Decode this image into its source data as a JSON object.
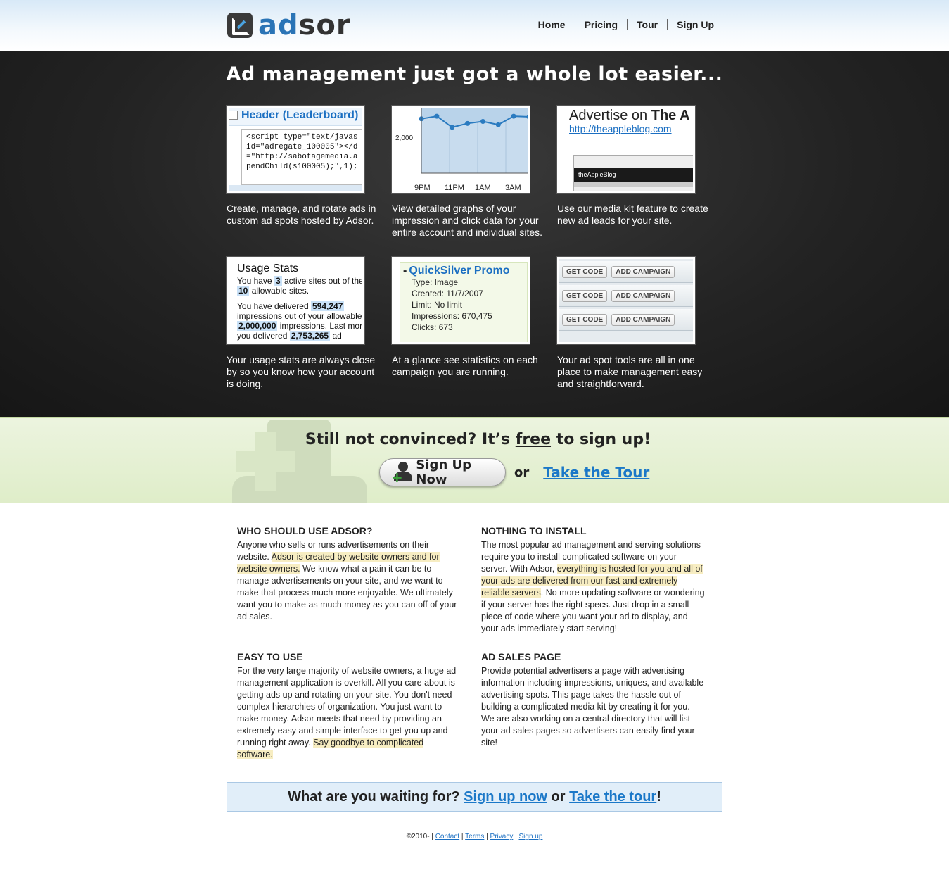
{
  "brand": {
    "logo_ad": "ad",
    "logo_sor": "sor"
  },
  "nav": {
    "home": "Home",
    "pricing": "Pricing",
    "tour": "Tour",
    "signup": "Sign Up"
  },
  "hero": {
    "title": "Ad management just got a whole lot easier..."
  },
  "features": [
    {
      "caption": "Create, manage, and rotate ads in custom ad spots hosted by Adsor."
    },
    {
      "caption": "View detailed graphs of your impression and click data for your entire account and individual sites."
    },
    {
      "caption": "Use our media kit feature to create new ad leads for your site."
    },
    {
      "caption": "Your usage stats are always close by so you know how your account is doing."
    },
    {
      "caption": "At a glance see statistics on each campaign you are running."
    },
    {
      "caption": "Your ad spot tools are all in one place to make management easy and straightforward."
    }
  ],
  "thumb1": {
    "title": "Header (Leaderboard)",
    "code": "<script type=\"text/javas\nid=\"adregate_100005\"></d\n=\"http://sabotagemedia.a\npendChild(s100005);\",1);"
  },
  "thumb2": {
    "y_label": "2,000",
    "x_labels": [
      "9PM",
      "11PM",
      "1AM",
      "3AM"
    ],
    "values": [
      0.83,
      0.87,
      0.7,
      0.76,
      0.79,
      0.74,
      0.87,
      0.86
    ]
  },
  "thumb3": {
    "heading_plain": "Advertise on ",
    "heading_bold": "The A",
    "link": "http://theappleblog.com",
    "shot_label": "theAppleBlog"
  },
  "thumb4": {
    "title": "Usage Stats",
    "l1a": "You have ",
    "n1": "3",
    "l1b": " active sites out of the",
    "n2": "10",
    "l2": " allowable sites.",
    "l3": "You have delivered ",
    "n3": "594,247",
    "l4": "impressions out of your allowable",
    "n4": "2,000,000",
    "l5": " impressions. Last mor",
    "l6": "you delivered ",
    "n5": "2,753,265",
    "l7": " ad"
  },
  "thumb5": {
    "title": "QuickSilver Promo",
    "type": "Type: Image",
    "created": "Created: 11/7/2007",
    "limit": "Limit: No limit",
    "impressions": "Impressions: 670,475",
    "clicks": "Clicks: 673"
  },
  "thumb6": {
    "get_code": "GET CODE",
    "add_campaign": "ADD CAMPAIGN"
  },
  "cta": {
    "title_a": "Still not convinced? It’s ",
    "title_free": "free",
    "title_b": " to sign up!",
    "signup_button": "Sign Up Now",
    "or": "or",
    "tour_link": "Take the Tour"
  },
  "info": {
    "who": {
      "title": "WHO SHOULD USE ADSOR?",
      "a": "Anyone who sells or runs advertisements on their website. ",
      "mark": "Adsor is created by website owners and for website owners.",
      "b": " We know what a pain it can be to manage advertisements on your site, and we want to make that process much more enjoyable. We ultimately want you to make as much money as you can off of your ad sales."
    },
    "install": {
      "title": "NOTHING TO INSTALL",
      "a": "The most popular ad management and serving solutions require you to install complicated software on your server. With Adsor, ",
      "mark": "everything is hosted for you and all of your ads are delivered from our fast and extremely reliable servers",
      "b": ". No more updating software or wondering if your server has the right specs. Just drop in a small piece of code where you want your ad to display, and your ads immediately start serving!"
    },
    "easy": {
      "title": "EASY TO USE",
      "a": "For the very large majority of website owners, a huge ad management application is overkill. All you care about is getting ads up and rotating on your site. You don't need complex hierarchies of organization. You just want to make money. Adsor meets that need by providing an extremely easy and simple interface to get you up and running right away. ",
      "mark": "Say goodbye to complicated software."
    },
    "sales": {
      "title": "AD SALES PAGE",
      "a": "Provide potential advertisers a page with advertising information including impressions, uniques, and available advertising spots. This page takes the hassle out of building a complicated media kit by creating it for you. We are also working on a central directory that will list your ad sales pages so advertisers can easily find your site!"
    }
  },
  "bottom_cta": {
    "a": "What are you waiting for? ",
    "signup": "Sign up now",
    "or": " or ",
    "tour": "Take the tour",
    "end": "!"
  },
  "footer": {
    "copy": "©2010- | ",
    "contact": "Contact",
    "terms": "Terms",
    "privacy": "Privacy",
    "signup": "Sign up",
    "sep": " | "
  },
  "colors": {
    "accent": "#1b78c8",
    "brand_blue": "#2a74b6",
    "dark_band": "#232323",
    "cta_green": "#e4efd2",
    "highlight": "#f7edc2"
  }
}
